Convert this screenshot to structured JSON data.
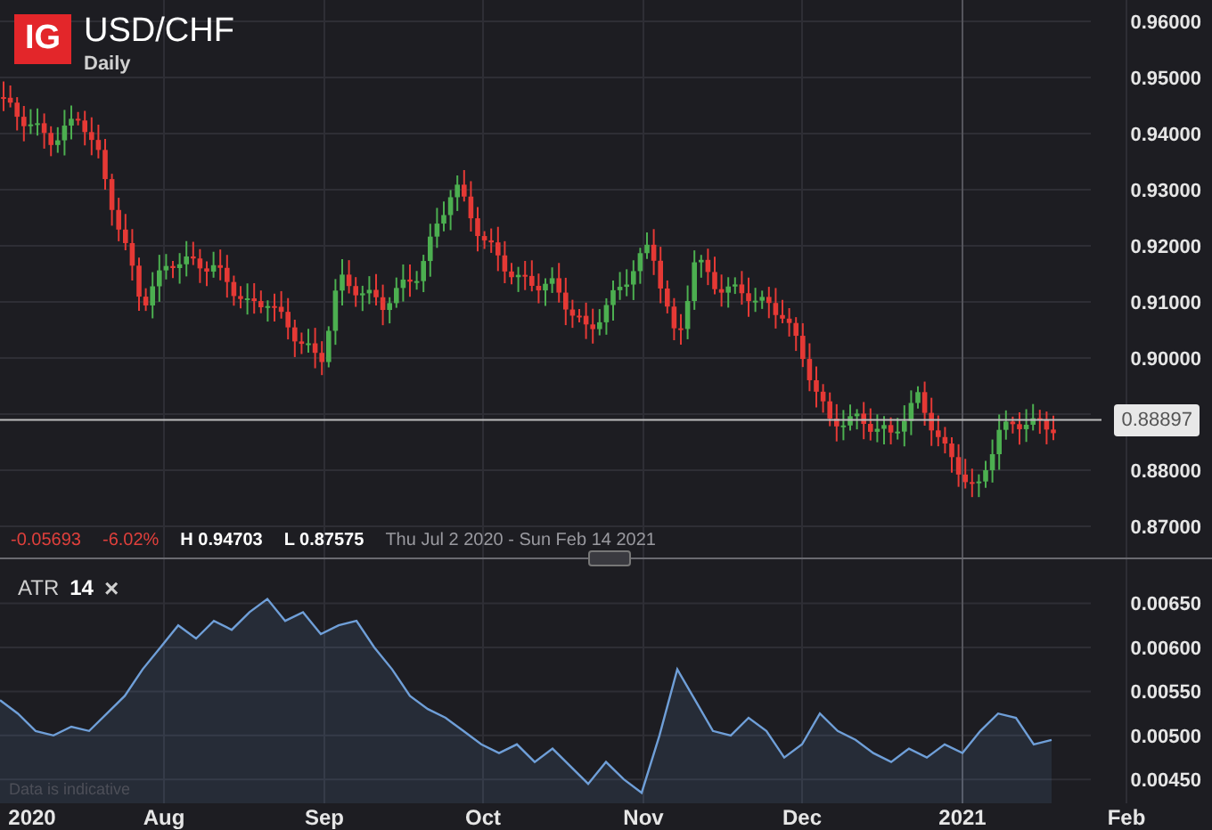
{
  "header": {
    "logo": "IG",
    "symbol": "USD/CHF",
    "interval": "Daily"
  },
  "price_axis": {
    "labels": [
      "0.96000",
      "0.95000",
      "0.94000",
      "0.93000",
      "0.92000",
      "0.91000",
      "0.90000",
      "0.88000",
      "0.87000"
    ]
  },
  "last_price": "0.88897",
  "stats": {
    "change": "-0.05693",
    "change_percent": "-6.02%",
    "high": "H 0.94703",
    "low": "L 0.87575",
    "range": "Thu Jul 2 2020 - Sun Feb 14 2021"
  },
  "indicator": {
    "name": "ATR",
    "period": "14",
    "close": "×",
    "chart_data": {
      "type": "area",
      "grid": true,
      "ylim": [
        0.00423,
        0.007
      ],
      "yticks": [
        {
          "value": 0.0065,
          "label": "0.00650"
        },
        {
          "value": 0.006,
          "label": "0.00600"
        },
        {
          "value": 0.0055,
          "label": "0.00550"
        },
        {
          "value": 0.005,
          "label": "0.00500"
        },
        {
          "value": 0.0045,
          "label": "0.00450"
        }
      ],
      "series": [
        {
          "color": "#6f9fd8",
          "values": [
            0.0054,
            0.00525,
            0.00505,
            0.005,
            0.0051,
            0.00505,
            0.00525,
            0.00545,
            0.00575,
            0.006,
            0.00625,
            0.0061,
            0.0063,
            0.0062,
            0.0064,
            0.00655,
            0.0063,
            0.0064,
            0.00615,
            0.00625,
            0.0063,
            0.006,
            0.00575,
            0.00545,
            0.0053,
            0.0052,
            0.00505,
            0.0049,
            0.0048,
            0.0049,
            0.0047,
            0.00485,
            0.00465,
            0.00445,
            0.0047,
            0.0045,
            0.00435,
            0.005,
            0.00575,
            0.0054,
            0.00505,
            0.005,
            0.0052,
            0.00505,
            0.00475,
            0.0049,
            0.00525,
            0.00505,
            0.00495,
            0.0048,
            0.0047,
            0.00485,
            0.00475,
            0.0049,
            0.0048,
            0.00505,
            0.00525,
            0.0052,
            0.0049,
            0.00495
          ]
        }
      ]
    }
  },
  "note": "Data is indicative",
  "time_axis": [
    "2020",
    "Aug",
    "Sep",
    "Oct",
    "Nov",
    "Dec",
    "2021",
    "Feb"
  ]
}
